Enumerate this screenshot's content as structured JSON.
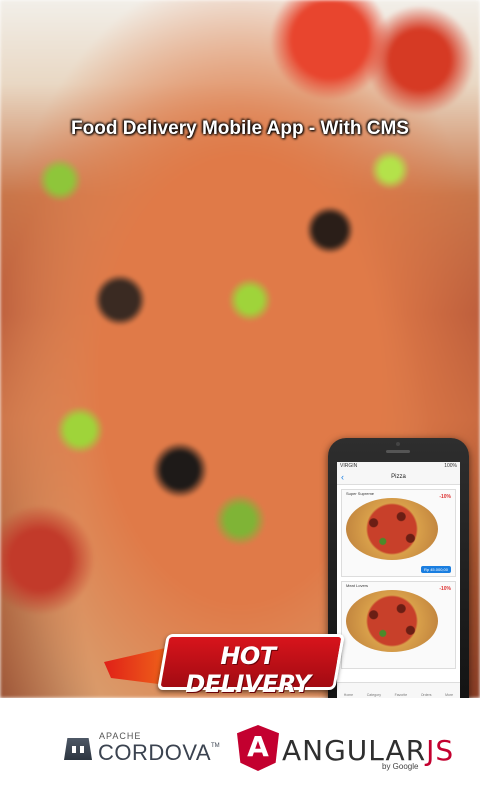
{
  "hero": {
    "title": "Food Delivery Mobile App - With CMS"
  },
  "phone": {
    "status_left": "VIRGIN",
    "status_right": "100%",
    "nav_title": "Pizza",
    "cards": [
      {
        "title": "Super Supreme",
        "badge": "-10%",
        "price": "Rp 45.000,00"
      },
      {
        "title": "Meat Lovers",
        "badge": "-10%",
        "price": ""
      }
    ],
    "tabs": [
      "Home",
      "Category",
      "Favorite",
      "Orders",
      "More"
    ]
  },
  "badge": {
    "text": "HOT DELIVERY"
  },
  "footer": {
    "apache": "APACHE",
    "cordova": "CORDOVA",
    "tm": "TM",
    "angular_main": "ANGULAR",
    "angular_js": "JS",
    "by_google": "by Google"
  },
  "colors": {
    "accent": "#c3002f",
    "badge_red": "#d8141c",
    "ios_blue": "#1a7ee0"
  }
}
